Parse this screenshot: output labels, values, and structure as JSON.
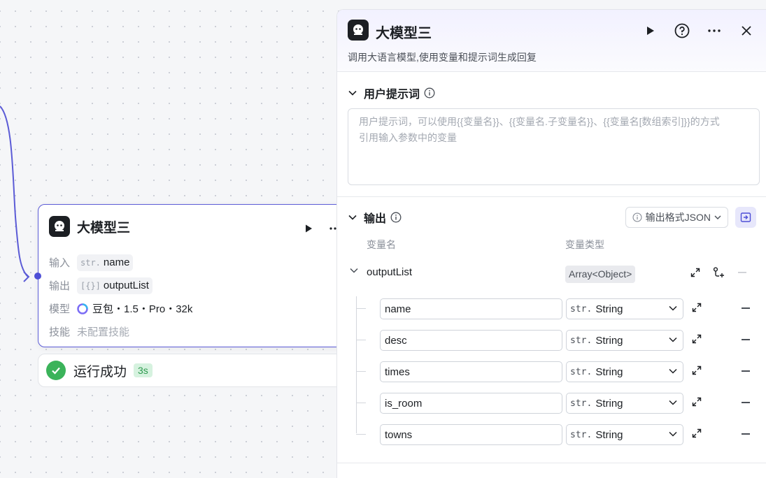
{
  "node": {
    "title": "大模型三",
    "input_label": "输入",
    "input_type_prefix": "str.",
    "input_value": "name",
    "output_label": "输出",
    "output_type_prefix": "[{}]",
    "output_value": "outputList",
    "model_label": "模型",
    "model_value": "豆包・1.5・Pro・32k",
    "skill_label": "技能",
    "skill_value": "未配置技能",
    "run_icon": "play-icon",
    "more_icon": "more-icon"
  },
  "status": {
    "text": "运行成功",
    "duration": "3s",
    "icon": "check-circle-icon"
  },
  "panel": {
    "title": "大模型三",
    "description": "调用大语言模型,使用变量和提示词生成回复",
    "actions": [
      "play-icon",
      "help-icon",
      "more-icon",
      "close-icon"
    ],
    "user_prompt": {
      "title": "用户提示词",
      "placeholder_line1": "用户提示词，可以使用{{变量名}}、{{变量名.子变量名}}、{{变量名[数组索引]}}的方式",
      "placeholder_line2": "引用输入参数中的变量"
    },
    "output": {
      "title": "输出",
      "format_button": "输出格式JSON",
      "col_name": "变量名",
      "col_type": "变量类型",
      "root": {
        "name": "outputList",
        "type": "Array<Object>"
      },
      "fields": [
        {
          "name": "name",
          "type_prefix": "str.",
          "type": "String"
        },
        {
          "name": "desc",
          "type_prefix": "str.",
          "type": "String"
        },
        {
          "name": "times",
          "type_prefix": "str.",
          "type": "String"
        },
        {
          "name": "is_room",
          "type_prefix": "str.",
          "type": "String"
        },
        {
          "name": "towns",
          "type_prefix": "str.",
          "type": "String"
        }
      ]
    }
  },
  "colors": {
    "accent": "#4e4fd6",
    "success": "#3bb35a",
    "node_border": "#5b5bd6"
  }
}
